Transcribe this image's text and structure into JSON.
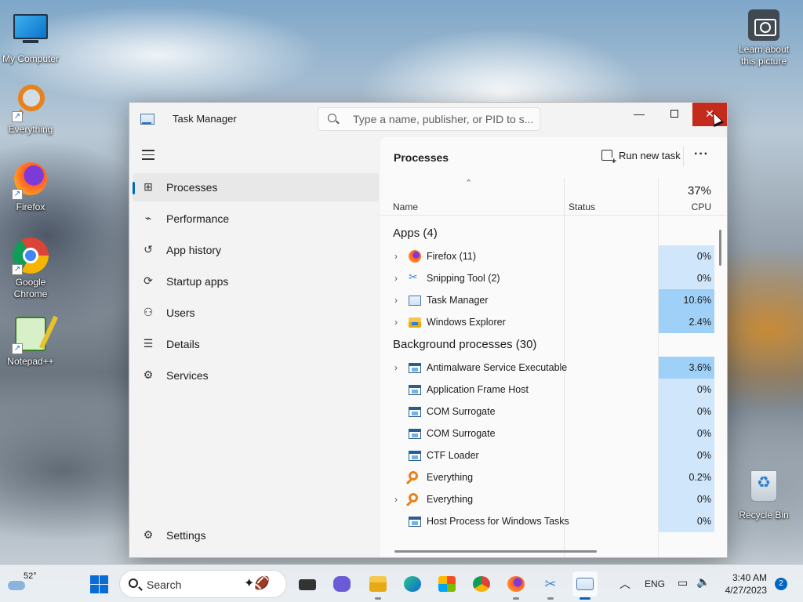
{
  "desktop": {
    "icons": [
      {
        "label": "My Computer",
        "icon": "monitor-icon"
      },
      {
        "label": "Everything",
        "icon": "everything-icon"
      },
      {
        "label": "Firefox",
        "icon": "firefox-icon"
      },
      {
        "label": "Google Chrome",
        "icon": "chrome-icon"
      },
      {
        "label": "Notepad++",
        "icon": "notepadpp-icon"
      },
      {
        "label": "Learn about this picture",
        "icon": "camera-icon"
      },
      {
        "label": "Recycle Bin",
        "icon": "recycle-bin-icon"
      }
    ]
  },
  "window": {
    "title": "Task Manager",
    "search_placeholder": "Type a name, publisher, or PID to s...",
    "controls": {
      "minimize": "—",
      "close": "✕"
    }
  },
  "sidebar": {
    "items": [
      {
        "label": "Processes",
        "icon": "processes-icon",
        "glyph": "⊞"
      },
      {
        "label": "Performance",
        "icon": "performance-icon",
        "glyph": "⌁"
      },
      {
        "label": "App history",
        "icon": "app-history-icon",
        "glyph": "↺"
      },
      {
        "label": "Startup apps",
        "icon": "startup-icon",
        "glyph": "⟳"
      },
      {
        "label": "Users",
        "icon": "users-icon",
        "glyph": "⚇"
      },
      {
        "label": "Details",
        "icon": "details-icon",
        "glyph": "☰"
      },
      {
        "label": "Services",
        "icon": "services-icon",
        "glyph": "⚙"
      }
    ],
    "settings": {
      "label": "Settings",
      "icon": "settings-icon",
      "glyph": "⚙"
    }
  },
  "content": {
    "title": "Processes",
    "run_new_task": "Run new task",
    "more": "···",
    "columns": {
      "name": "Name",
      "status": "Status",
      "cpu": "CPU",
      "cpu_total": "37%",
      "sort_caret": "⌃"
    },
    "groups": [
      {
        "label": "Apps (4)",
        "rows": [
          {
            "name": "Firefox (11)",
            "icon": "ic-firefox",
            "expandable": true,
            "cpu": "0%",
            "cpu_value": 0
          },
          {
            "name": "Snipping Tool (2)",
            "icon": "ic-snip",
            "expandable": true,
            "cpu": "0%",
            "cpu_value": 0
          },
          {
            "name": "Task Manager",
            "icon": "ic-tm",
            "expandable": true,
            "cpu": "10.6%",
            "cpu_value": 10.6
          },
          {
            "name": "Windows Explorer",
            "icon": "ic-explorer",
            "expandable": true,
            "cpu": "2.4%",
            "cpu_value": 2.4
          }
        ]
      },
      {
        "label": "Background processes (30)",
        "rows": [
          {
            "name": "Antimalware Service Executable",
            "icon": "ic-sys",
            "expandable": true,
            "cpu": "3.6%",
            "cpu_value": 3.6
          },
          {
            "name": "Application Frame Host",
            "icon": "ic-sys",
            "expandable": false,
            "cpu": "0%",
            "cpu_value": 0
          },
          {
            "name": "COM Surrogate",
            "icon": "ic-sys",
            "expandable": false,
            "cpu": "0%",
            "cpu_value": 0
          },
          {
            "name": "COM Surrogate",
            "icon": "ic-sys",
            "expandable": false,
            "cpu": "0%",
            "cpu_value": 0
          },
          {
            "name": "CTF Loader",
            "icon": "ic-sys",
            "expandable": false,
            "cpu": "0%",
            "cpu_value": 0
          },
          {
            "name": "Everything",
            "icon": "ic-every",
            "expandable": false,
            "cpu": "0.2%",
            "cpu_value": 0.2
          },
          {
            "name": "Everything",
            "icon": "ic-every",
            "expandable": true,
            "cpu": "0%",
            "cpu_value": 0
          },
          {
            "name": "Host Process for Windows Tasks",
            "icon": "ic-sys",
            "expandable": false,
            "cpu": "0%",
            "cpu_value": 0
          }
        ]
      }
    ]
  },
  "taskbar": {
    "weather_temp": "52°",
    "search_label": "Search",
    "language": "ENG",
    "time": "3:40 AM",
    "date": "4/27/2023",
    "notifications": "2",
    "colors": {
      "accent": "#0067c0",
      "cpu_low": "#cfe6fb",
      "cpu_mid": "#9fd0f7",
      "close": "#c42b1c"
    }
  }
}
